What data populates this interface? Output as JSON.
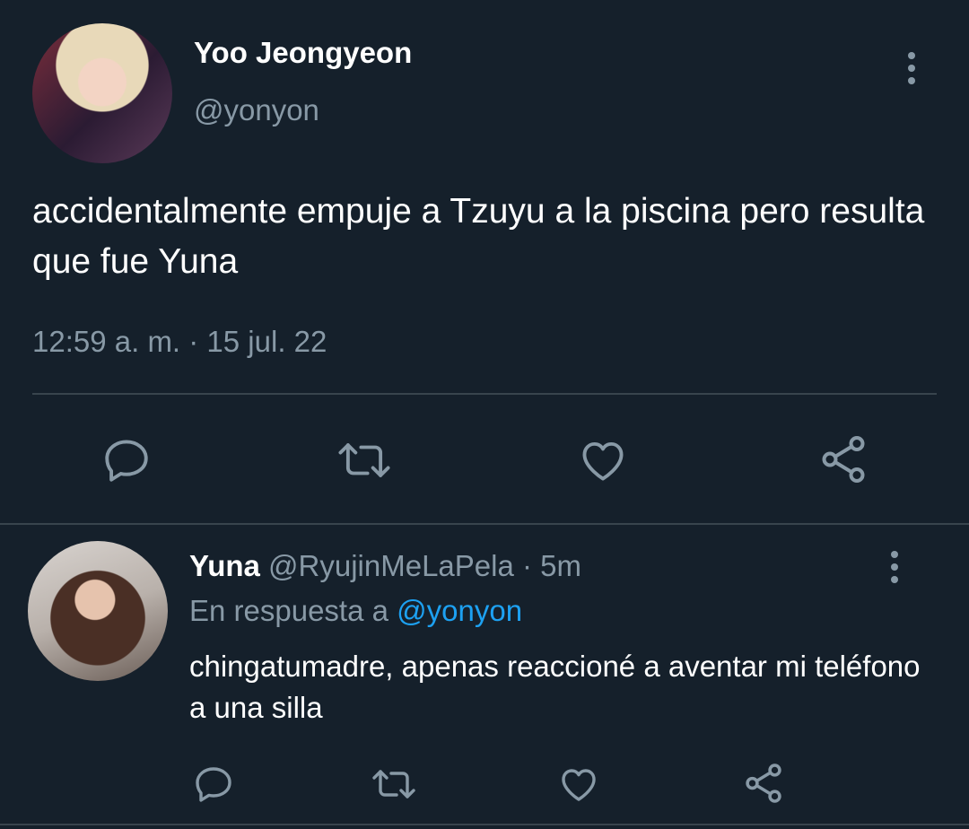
{
  "tweet": {
    "author_name": "Yoo Jeongyeon",
    "author_handle": "@yonyon",
    "text": "accidentalmente empuje a Tzuyu a la piscina pero resulta que fue Yuna",
    "timestamp": "12:59 a. m. · 15 jul. 22",
    "actions": [
      "reply-icon",
      "retweet-icon",
      "like-icon",
      "share-icon"
    ]
  },
  "reply": {
    "author_name": "Yuna",
    "author_handle": "@RyujinMeLaPela",
    "separator": "·",
    "age": "5m",
    "replying_prefix": "En respuesta a",
    "replying_to": "@yonyon",
    "text": "chingatumadre, apenas reaccioné a aventar mi teléfono a una silla",
    "actions": [
      "reply-icon",
      "retweet-icon",
      "like-icon",
      "share-icon"
    ]
  },
  "colors": {
    "background": "#15202b",
    "text_primary": "#ffffff",
    "text_secondary": "#8899a6",
    "link": "#1da1f2",
    "divider": "#38444d"
  }
}
